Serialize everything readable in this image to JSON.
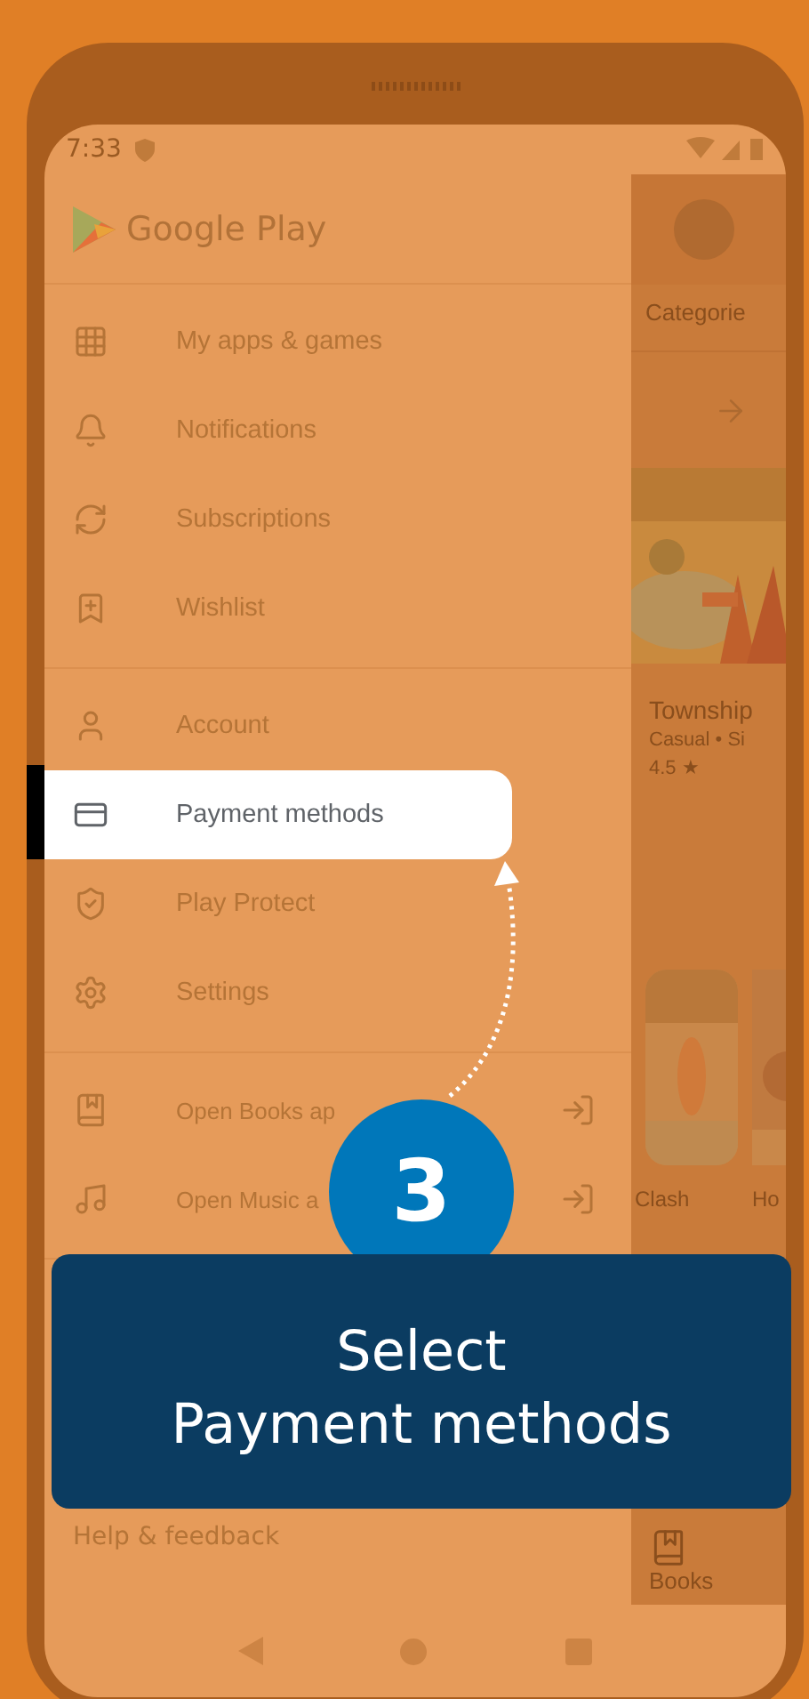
{
  "status_bar": {
    "time": "7:33"
  },
  "drawer": {
    "title": "Google Play",
    "sections": [
      {
        "items": [
          {
            "label": "My apps & games",
            "kind": "menu",
            "selected": false
          },
          {
            "label": "Notifications",
            "kind": "menu",
            "selected": false
          },
          {
            "label": "Subscriptions",
            "kind": "menu",
            "selected": false
          },
          {
            "label": "Wishlist",
            "kind": "menu",
            "selected": false
          }
        ]
      },
      {
        "items": [
          {
            "label": "Account",
            "kind": "menu",
            "selected": false
          },
          {
            "label": "Payment methods",
            "kind": "menu",
            "selected": true
          },
          {
            "label": "Play Protect",
            "kind": "menu",
            "selected": false
          },
          {
            "label": "Settings",
            "kind": "menu",
            "selected": false
          }
        ]
      },
      {
        "items": [
          {
            "label": "Open Books ap",
            "kind": "app-link",
            "selected": false
          },
          {
            "label": "Open Music a",
            "kind": "app-link",
            "selected": false
          }
        ]
      }
    ],
    "footer": "Help & feedback"
  },
  "background_app": {
    "tab": "Categorie",
    "game": {
      "title": "Township",
      "meta": "Casual • Si",
      "rating": "4.5 ★"
    },
    "tiles": [
      "Clash",
      "Ho"
    ],
    "nav_item": "Books"
  },
  "tutorial": {
    "step": "3",
    "lines": [
      "Select",
      "Payment methods"
    ]
  }
}
